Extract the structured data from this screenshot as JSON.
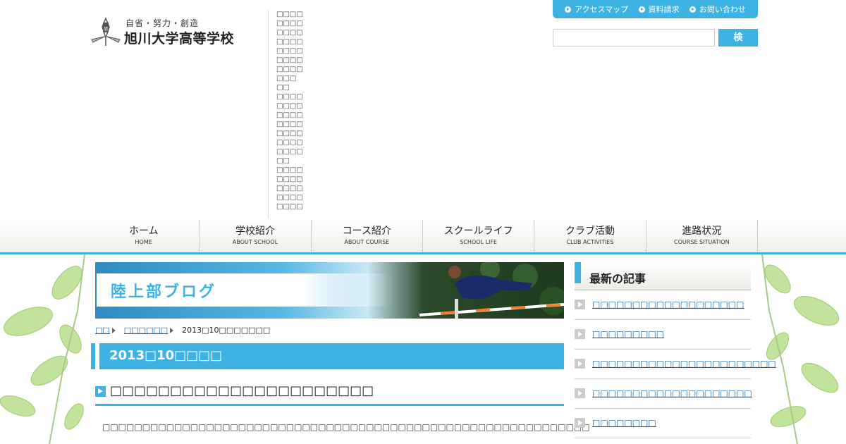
{
  "header": {
    "motto": "自省・努力・創造",
    "school_name": "旭川大学高等学校",
    "garbled_lines": [
      "□□□□",
      "□□□□",
      "□□□□",
      "□□□□",
      "□□□□",
      "□□□□",
      "□□□□",
      "□□□",
      "□□",
      "□□□□",
      "□□□□",
      "□□□□",
      "□□□□",
      "□□□□",
      "□□□□",
      "□□□□",
      "□□",
      "□□□□",
      "□□□□",
      "□□□□",
      "□□□□",
      "□□□□"
    ]
  },
  "utility": {
    "links": [
      {
        "label": "アクセスマップ",
        "icon": "arrow-circle-icon"
      },
      {
        "label": "資料請求",
        "icon": "arrow-circle-icon"
      },
      {
        "label": "お問い合わせ",
        "icon": "arrow-circle-icon"
      }
    ]
  },
  "search": {
    "placeholder": "",
    "value": "",
    "button_label": "検 索"
  },
  "nav": [
    {
      "ja": "ホーム",
      "en": "HOME"
    },
    {
      "ja": "学校紹介",
      "en": "ABOUT SCHOOL"
    },
    {
      "ja": "コース紹介",
      "en": "ABOUT COURSE"
    },
    {
      "ja": "スクールライフ",
      "en": "SCHOOL LIFE"
    },
    {
      "ja": "クラブ活動",
      "en": "CLUB ACTIVITIES"
    },
    {
      "ja": "進路状況",
      "en": "COURSE SITUATION"
    }
  ],
  "banner": {
    "title": "陸上部ブログ"
  },
  "breadcrumb": {
    "items": [
      "□□",
      "□□□□□□"
    ],
    "current": "2013□10□□□□□□□"
  },
  "archive": {
    "heading": "2013□10□□□□"
  },
  "post": {
    "title": "□□□□□□□□□□□□□□□□□□□□□□",
    "body": "□□□□□□□□□□□□□□□□□□□□□□□□□□□□□□□□□□□□□□□□□□□□□□□□□□□□□□□□□□□□□"
  },
  "sidebar": {
    "heading": "最新の記事",
    "items": [
      "□□□□□□□□□□□□□□□□□□□",
      "□□□□□□□□□",
      "□□□□□□□□□□□□□□□□□□□□□□□",
      "□□□□□□□□□□□□□□□□□□□□",
      "□□□□□□□□"
    ]
  },
  "colors": {
    "accent": "#3eb3e3",
    "link": "#0b5fa8"
  }
}
